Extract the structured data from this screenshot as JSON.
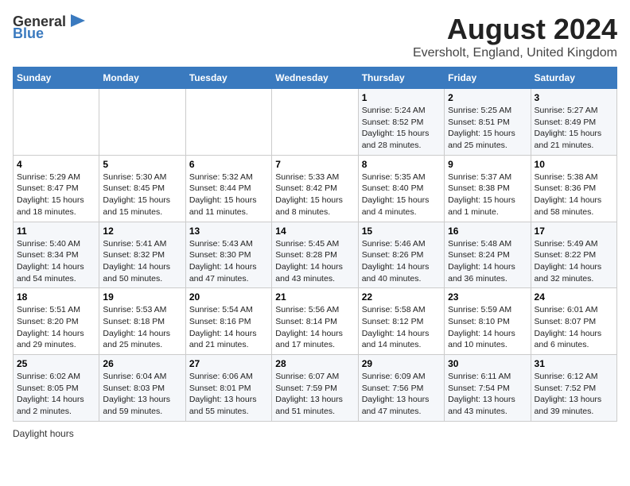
{
  "header": {
    "logo_general": "General",
    "logo_blue": "Blue",
    "main_title": "August 2024",
    "subtitle": "Eversholt, England, United Kingdom"
  },
  "calendar": {
    "days_of_week": [
      "Sunday",
      "Monday",
      "Tuesday",
      "Wednesday",
      "Thursday",
      "Friday",
      "Saturday"
    ],
    "weeks": [
      [
        {
          "day": "",
          "info": ""
        },
        {
          "day": "",
          "info": ""
        },
        {
          "day": "",
          "info": ""
        },
        {
          "day": "",
          "info": ""
        },
        {
          "day": "1",
          "info": "Sunrise: 5:24 AM\nSunset: 8:52 PM\nDaylight: 15 hours\nand 28 minutes."
        },
        {
          "day": "2",
          "info": "Sunrise: 5:25 AM\nSunset: 8:51 PM\nDaylight: 15 hours\nand 25 minutes."
        },
        {
          "day": "3",
          "info": "Sunrise: 5:27 AM\nSunset: 8:49 PM\nDaylight: 15 hours\nand 21 minutes."
        }
      ],
      [
        {
          "day": "4",
          "info": "Sunrise: 5:29 AM\nSunset: 8:47 PM\nDaylight: 15 hours\nand 18 minutes."
        },
        {
          "day": "5",
          "info": "Sunrise: 5:30 AM\nSunset: 8:45 PM\nDaylight: 15 hours\nand 15 minutes."
        },
        {
          "day": "6",
          "info": "Sunrise: 5:32 AM\nSunset: 8:44 PM\nDaylight: 15 hours\nand 11 minutes."
        },
        {
          "day": "7",
          "info": "Sunrise: 5:33 AM\nSunset: 8:42 PM\nDaylight: 15 hours\nand 8 minutes."
        },
        {
          "day": "8",
          "info": "Sunrise: 5:35 AM\nSunset: 8:40 PM\nDaylight: 15 hours\nand 4 minutes."
        },
        {
          "day": "9",
          "info": "Sunrise: 5:37 AM\nSunset: 8:38 PM\nDaylight: 15 hours\nand 1 minute."
        },
        {
          "day": "10",
          "info": "Sunrise: 5:38 AM\nSunset: 8:36 PM\nDaylight: 14 hours\nand 58 minutes."
        }
      ],
      [
        {
          "day": "11",
          "info": "Sunrise: 5:40 AM\nSunset: 8:34 PM\nDaylight: 14 hours\nand 54 minutes."
        },
        {
          "day": "12",
          "info": "Sunrise: 5:41 AM\nSunset: 8:32 PM\nDaylight: 14 hours\nand 50 minutes."
        },
        {
          "day": "13",
          "info": "Sunrise: 5:43 AM\nSunset: 8:30 PM\nDaylight: 14 hours\nand 47 minutes."
        },
        {
          "day": "14",
          "info": "Sunrise: 5:45 AM\nSunset: 8:28 PM\nDaylight: 14 hours\nand 43 minutes."
        },
        {
          "day": "15",
          "info": "Sunrise: 5:46 AM\nSunset: 8:26 PM\nDaylight: 14 hours\nand 40 minutes."
        },
        {
          "day": "16",
          "info": "Sunrise: 5:48 AM\nSunset: 8:24 PM\nDaylight: 14 hours\nand 36 minutes."
        },
        {
          "day": "17",
          "info": "Sunrise: 5:49 AM\nSunset: 8:22 PM\nDaylight: 14 hours\nand 32 minutes."
        }
      ],
      [
        {
          "day": "18",
          "info": "Sunrise: 5:51 AM\nSunset: 8:20 PM\nDaylight: 14 hours\nand 29 minutes."
        },
        {
          "day": "19",
          "info": "Sunrise: 5:53 AM\nSunset: 8:18 PM\nDaylight: 14 hours\nand 25 minutes."
        },
        {
          "day": "20",
          "info": "Sunrise: 5:54 AM\nSunset: 8:16 PM\nDaylight: 14 hours\nand 21 minutes."
        },
        {
          "day": "21",
          "info": "Sunrise: 5:56 AM\nSunset: 8:14 PM\nDaylight: 14 hours\nand 17 minutes."
        },
        {
          "day": "22",
          "info": "Sunrise: 5:58 AM\nSunset: 8:12 PM\nDaylight: 14 hours\nand 14 minutes."
        },
        {
          "day": "23",
          "info": "Sunrise: 5:59 AM\nSunset: 8:10 PM\nDaylight: 14 hours\nand 10 minutes."
        },
        {
          "day": "24",
          "info": "Sunrise: 6:01 AM\nSunset: 8:07 PM\nDaylight: 14 hours\nand 6 minutes."
        }
      ],
      [
        {
          "day": "25",
          "info": "Sunrise: 6:02 AM\nSunset: 8:05 PM\nDaylight: 14 hours\nand 2 minutes."
        },
        {
          "day": "26",
          "info": "Sunrise: 6:04 AM\nSunset: 8:03 PM\nDaylight: 13 hours\nand 59 minutes."
        },
        {
          "day": "27",
          "info": "Sunrise: 6:06 AM\nSunset: 8:01 PM\nDaylight: 13 hours\nand 55 minutes."
        },
        {
          "day": "28",
          "info": "Sunrise: 6:07 AM\nSunset: 7:59 PM\nDaylight: 13 hours\nand 51 minutes."
        },
        {
          "day": "29",
          "info": "Sunrise: 6:09 AM\nSunset: 7:56 PM\nDaylight: 13 hours\nand 47 minutes."
        },
        {
          "day": "30",
          "info": "Sunrise: 6:11 AM\nSunset: 7:54 PM\nDaylight: 13 hours\nand 43 minutes."
        },
        {
          "day": "31",
          "info": "Sunrise: 6:12 AM\nSunset: 7:52 PM\nDaylight: 13 hours\nand 39 minutes."
        }
      ]
    ]
  },
  "footer": {
    "note": "Daylight hours"
  }
}
